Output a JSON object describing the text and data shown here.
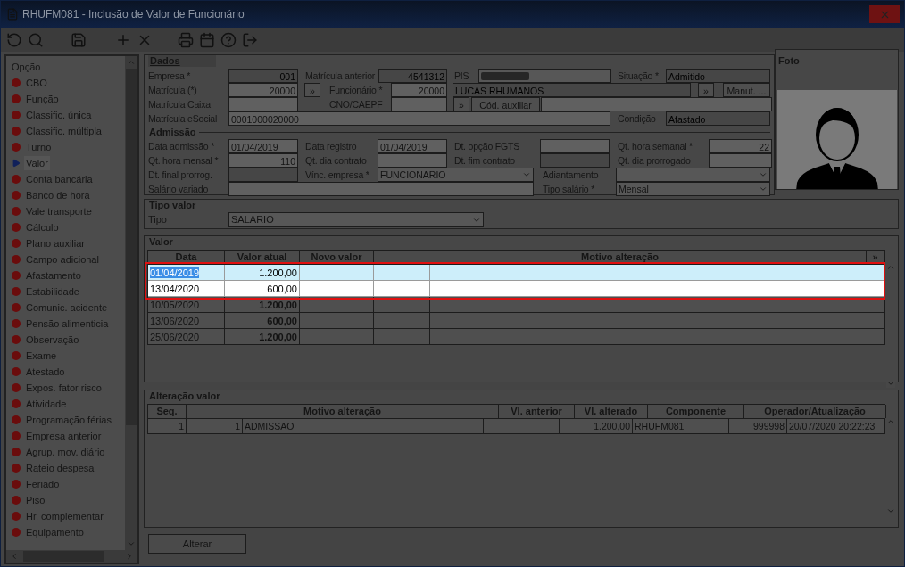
{
  "window": {
    "title": "RHUFM081 - Inclusão de Valor de Funcionário"
  },
  "sidebar": {
    "header": "Opção",
    "items": [
      {
        "label": "CBO",
        "selected": false
      },
      {
        "label": "Função",
        "selected": false
      },
      {
        "label": "Classific. única",
        "selected": false
      },
      {
        "label": "Classific. múltipla",
        "selected": false
      },
      {
        "label": "Turno",
        "selected": false
      },
      {
        "label": "Valor",
        "selected": true
      },
      {
        "label": "Conta bancária",
        "selected": false
      },
      {
        "label": "Banco de hora",
        "selected": false
      },
      {
        "label": "Vale transporte",
        "selected": false
      },
      {
        "label": "Cálculo",
        "selected": false
      },
      {
        "label": "Plano auxiliar",
        "selected": false
      },
      {
        "label": "Campo adicional",
        "selected": false
      },
      {
        "label": "Afastamento",
        "selected": false
      },
      {
        "label": "Estabilidade",
        "selected": false
      },
      {
        "label": "Comunic. acidente",
        "selected": false
      },
      {
        "label": "Pensão alimenticia",
        "selected": false
      },
      {
        "label": "Observação",
        "selected": false
      },
      {
        "label": "Exame",
        "selected": false
      },
      {
        "label": "Atestado",
        "selected": false
      },
      {
        "label": "Expos. fator risco",
        "selected": false
      },
      {
        "label": "Atividade",
        "selected": false
      },
      {
        "label": "Programação férias",
        "selected": false
      },
      {
        "label": "Empresa anterior",
        "selected": false
      },
      {
        "label": "Agrup. mov. diário",
        "selected": false
      },
      {
        "label": "Rateio despesa",
        "selected": false
      },
      {
        "label": "Feriado",
        "selected": false
      },
      {
        "label": "Piso",
        "selected": false
      },
      {
        "label": "Hr. complementar",
        "selected": false
      },
      {
        "label": "Equipamento",
        "selected": false
      }
    ]
  },
  "dados": {
    "title": "Dados",
    "lines": [
      {
        "items": [
          {
            "kind": "label",
            "text": "Empresa *"
          },
          {
            "kind": "field",
            "value": "001",
            "disabled": true
          },
          {
            "kind": "label",
            "text": "Matrícula anterior"
          },
          {
            "kind": "field",
            "value": "4541312",
            "disabled": true
          },
          {
            "kind": "label",
            "text": "PIS"
          },
          {
            "kind": "masked"
          },
          {
            "kind": "label",
            "text": "Situação *"
          },
          {
            "kind": "field",
            "value": "Admitido",
            "disabled": true
          }
        ]
      },
      {
        "items": [
          {
            "kind": "label",
            "text": "Matrícula (*)"
          },
          {
            "kind": "field",
            "value": "20000",
            "disabled": false
          },
          {
            "kind": "button",
            "text": "»"
          },
          {
            "kind": "label",
            "text": "Funcionário *"
          },
          {
            "kind": "field",
            "value": "20000",
            "disabled": false
          },
          {
            "kind": "field",
            "value": "LUCAS RHUMANOS",
            "disabled": true
          },
          {
            "kind": "button",
            "text": "»"
          },
          {
            "kind": "button",
            "text": "Manut. ..."
          }
        ]
      },
      {
        "items": [
          {
            "kind": "label",
            "text": "Matrícula Caixa"
          },
          {
            "kind": "field",
            "disabled": false
          },
          {
            "kind": "label",
            "text": "CNO/CAEPF"
          },
          {
            "kind": "field",
            "disabled": false
          },
          {
            "kind": "button",
            "text": "»"
          },
          {
            "kind": "button",
            "text": "Cód. auxiliar"
          },
          {
            "kind": "field",
            "disabled": false
          }
        ]
      },
      {
        "items": [
          {
            "kind": "label",
            "text": "Matrícula eSocial"
          },
          {
            "kind": "field",
            "value": "0001000020000",
            "disabled": false
          },
          {
            "kind": "label",
            "text": "Condição"
          },
          {
            "kind": "field",
            "value": "Afastado",
            "disabled": true
          }
        ]
      }
    ]
  },
  "admissao": {
    "title": "Admissão",
    "lines": [
      {
        "items": [
          {
            "kind": "label",
            "text": "Data admissão *"
          },
          {
            "kind": "field",
            "value": "01/04/2019",
            "disabled": false
          },
          {
            "kind": "label",
            "text": "Data registro"
          },
          {
            "kind": "field",
            "value": "01/04/2019",
            "disabled": false
          },
          {
            "kind": "label",
            "text": "Dt. opção FGTS"
          },
          {
            "kind": "field",
            "disabled": false
          },
          {
            "kind": "label",
            "text": "Qt. hora semanal *"
          },
          {
            "kind": "field",
            "value": "22",
            "disabled": false
          }
        ]
      },
      {
        "items": [
          {
            "kind": "label",
            "text": "Qt. hora mensal *"
          },
          {
            "kind": "field",
            "value": "110",
            "disabled": false
          },
          {
            "kind": "label",
            "text": "Qt. dia contrato"
          },
          {
            "kind": "field",
            "disabled": false
          },
          {
            "kind": "label",
            "text": "Dt. fim contrato"
          },
          {
            "kind": "field",
            "disabled": true
          },
          {
            "kind": "label",
            "text": "Qt. dia prorrogado"
          },
          {
            "kind": "field",
            "disabled": false
          }
        ]
      },
      {
        "items": [
          {
            "kind": "label",
            "text": "Dt. final prorrog."
          },
          {
            "kind": "field",
            "disabled": true
          },
          {
            "kind": "label",
            "text": "Vínc. empresa *"
          },
          {
            "kind": "select",
            "value": "FUNCIONARIO"
          },
          {
            "kind": "label",
            "text": "Adiantamento"
          },
          {
            "kind": "select"
          }
        ]
      },
      {
        "items": [
          {
            "kind": "label",
            "text": "Salário variado"
          },
          {
            "kind": "field",
            "disabled": false
          },
          {
            "kind": "label",
            "text": "Tipo salário *"
          },
          {
            "kind": "select",
            "value": "Mensal"
          }
        ]
      }
    ]
  },
  "foto": {
    "title": "Foto"
  },
  "tipo_valor": {
    "title": "Tipo valor",
    "label": "Tipo",
    "value": "SALARIO"
  },
  "valor": {
    "title": "Valor",
    "columns": [
      "Data",
      "Valor atual",
      "Novo valor",
      "Motivo alteração"
    ],
    "more_button": "»",
    "rows": [
      {
        "data": "01/04/2019",
        "valor_atual": "1.200,00",
        "highlighted": true,
        "selected": true
      },
      {
        "data": "13/04/2020",
        "valor_atual": "600,00",
        "highlighted": true,
        "selected": false
      },
      {
        "data": "10/05/2020",
        "valor_atual": "1.200,00",
        "highlighted": false,
        "selected": false
      },
      {
        "data": "13/06/2020",
        "valor_atual": "600,00",
        "highlighted": false,
        "selected": false
      },
      {
        "data": "25/06/2020",
        "valor_atual": "1.200,00",
        "highlighted": false,
        "selected": false
      }
    ]
  },
  "alteracao": {
    "title": "Alteração valor",
    "columns": [
      "Seq.",
      "Motivo alteração",
      "Vl. anterior",
      "Vl. alterado",
      "Componente",
      "Operador/Atualização"
    ],
    "rows": [
      {
        "seq": "1",
        "motivo_codigo": "1",
        "motivo": "ADMISSAO",
        "vl_alterado": "1.200,00",
        "componente": "RHUFM081",
        "operador": "999998",
        "atualizacao": "20/07/2020 20:22:23"
      }
    ]
  },
  "buttons": [
    {
      "label": "Alterar"
    }
  ]
}
